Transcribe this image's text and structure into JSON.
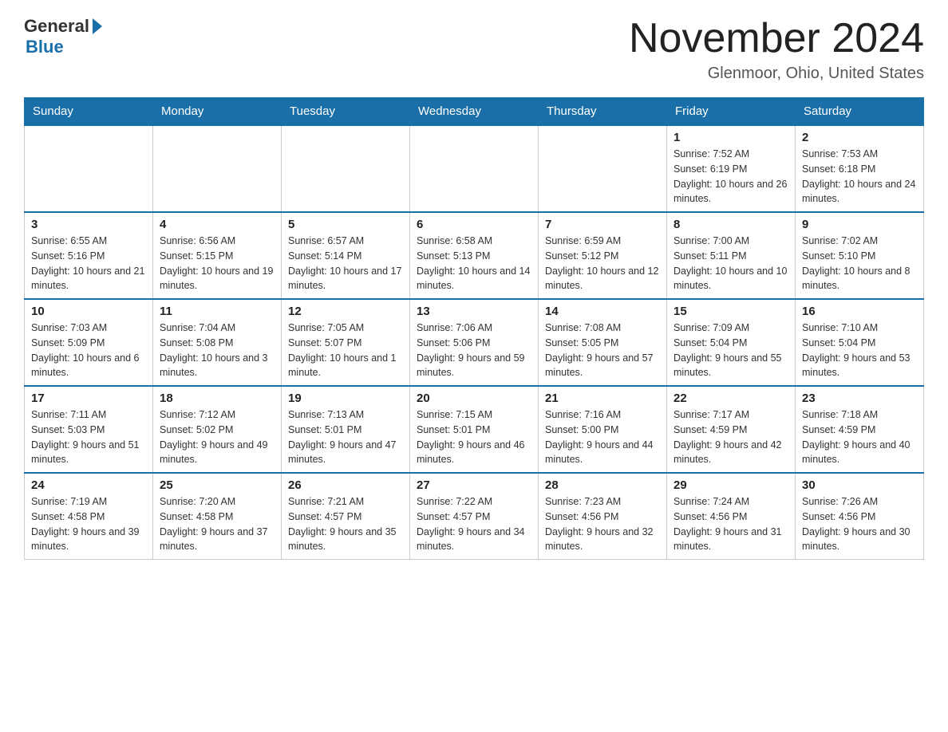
{
  "header": {
    "logo_general": "General",
    "logo_blue": "Blue",
    "title": "November 2024",
    "location": "Glenmoor, Ohio, United States"
  },
  "weekdays": [
    "Sunday",
    "Monday",
    "Tuesday",
    "Wednesday",
    "Thursday",
    "Friday",
    "Saturday"
  ],
  "weeks": [
    [
      {
        "day": "",
        "info": ""
      },
      {
        "day": "",
        "info": ""
      },
      {
        "day": "",
        "info": ""
      },
      {
        "day": "",
        "info": ""
      },
      {
        "day": "",
        "info": ""
      },
      {
        "day": "1",
        "info": "Sunrise: 7:52 AM\nSunset: 6:19 PM\nDaylight: 10 hours and 26 minutes."
      },
      {
        "day": "2",
        "info": "Sunrise: 7:53 AM\nSunset: 6:18 PM\nDaylight: 10 hours and 24 minutes."
      }
    ],
    [
      {
        "day": "3",
        "info": "Sunrise: 6:55 AM\nSunset: 5:16 PM\nDaylight: 10 hours and 21 minutes."
      },
      {
        "day": "4",
        "info": "Sunrise: 6:56 AM\nSunset: 5:15 PM\nDaylight: 10 hours and 19 minutes."
      },
      {
        "day": "5",
        "info": "Sunrise: 6:57 AM\nSunset: 5:14 PM\nDaylight: 10 hours and 17 minutes."
      },
      {
        "day": "6",
        "info": "Sunrise: 6:58 AM\nSunset: 5:13 PM\nDaylight: 10 hours and 14 minutes."
      },
      {
        "day": "7",
        "info": "Sunrise: 6:59 AM\nSunset: 5:12 PM\nDaylight: 10 hours and 12 minutes."
      },
      {
        "day": "8",
        "info": "Sunrise: 7:00 AM\nSunset: 5:11 PM\nDaylight: 10 hours and 10 minutes."
      },
      {
        "day": "9",
        "info": "Sunrise: 7:02 AM\nSunset: 5:10 PM\nDaylight: 10 hours and 8 minutes."
      }
    ],
    [
      {
        "day": "10",
        "info": "Sunrise: 7:03 AM\nSunset: 5:09 PM\nDaylight: 10 hours and 6 minutes."
      },
      {
        "day": "11",
        "info": "Sunrise: 7:04 AM\nSunset: 5:08 PM\nDaylight: 10 hours and 3 minutes."
      },
      {
        "day": "12",
        "info": "Sunrise: 7:05 AM\nSunset: 5:07 PM\nDaylight: 10 hours and 1 minute."
      },
      {
        "day": "13",
        "info": "Sunrise: 7:06 AM\nSunset: 5:06 PM\nDaylight: 9 hours and 59 minutes."
      },
      {
        "day": "14",
        "info": "Sunrise: 7:08 AM\nSunset: 5:05 PM\nDaylight: 9 hours and 57 minutes."
      },
      {
        "day": "15",
        "info": "Sunrise: 7:09 AM\nSunset: 5:04 PM\nDaylight: 9 hours and 55 minutes."
      },
      {
        "day": "16",
        "info": "Sunrise: 7:10 AM\nSunset: 5:04 PM\nDaylight: 9 hours and 53 minutes."
      }
    ],
    [
      {
        "day": "17",
        "info": "Sunrise: 7:11 AM\nSunset: 5:03 PM\nDaylight: 9 hours and 51 minutes."
      },
      {
        "day": "18",
        "info": "Sunrise: 7:12 AM\nSunset: 5:02 PM\nDaylight: 9 hours and 49 minutes."
      },
      {
        "day": "19",
        "info": "Sunrise: 7:13 AM\nSunset: 5:01 PM\nDaylight: 9 hours and 47 minutes."
      },
      {
        "day": "20",
        "info": "Sunrise: 7:15 AM\nSunset: 5:01 PM\nDaylight: 9 hours and 46 minutes."
      },
      {
        "day": "21",
        "info": "Sunrise: 7:16 AM\nSunset: 5:00 PM\nDaylight: 9 hours and 44 minutes."
      },
      {
        "day": "22",
        "info": "Sunrise: 7:17 AM\nSunset: 4:59 PM\nDaylight: 9 hours and 42 minutes."
      },
      {
        "day": "23",
        "info": "Sunrise: 7:18 AM\nSunset: 4:59 PM\nDaylight: 9 hours and 40 minutes."
      }
    ],
    [
      {
        "day": "24",
        "info": "Sunrise: 7:19 AM\nSunset: 4:58 PM\nDaylight: 9 hours and 39 minutes."
      },
      {
        "day": "25",
        "info": "Sunrise: 7:20 AM\nSunset: 4:58 PM\nDaylight: 9 hours and 37 minutes."
      },
      {
        "day": "26",
        "info": "Sunrise: 7:21 AM\nSunset: 4:57 PM\nDaylight: 9 hours and 35 minutes."
      },
      {
        "day": "27",
        "info": "Sunrise: 7:22 AM\nSunset: 4:57 PM\nDaylight: 9 hours and 34 minutes."
      },
      {
        "day": "28",
        "info": "Sunrise: 7:23 AM\nSunset: 4:56 PM\nDaylight: 9 hours and 32 minutes."
      },
      {
        "day": "29",
        "info": "Sunrise: 7:24 AM\nSunset: 4:56 PM\nDaylight: 9 hours and 31 minutes."
      },
      {
        "day": "30",
        "info": "Sunrise: 7:26 AM\nSunset: 4:56 PM\nDaylight: 9 hours and 30 minutes."
      }
    ]
  ]
}
